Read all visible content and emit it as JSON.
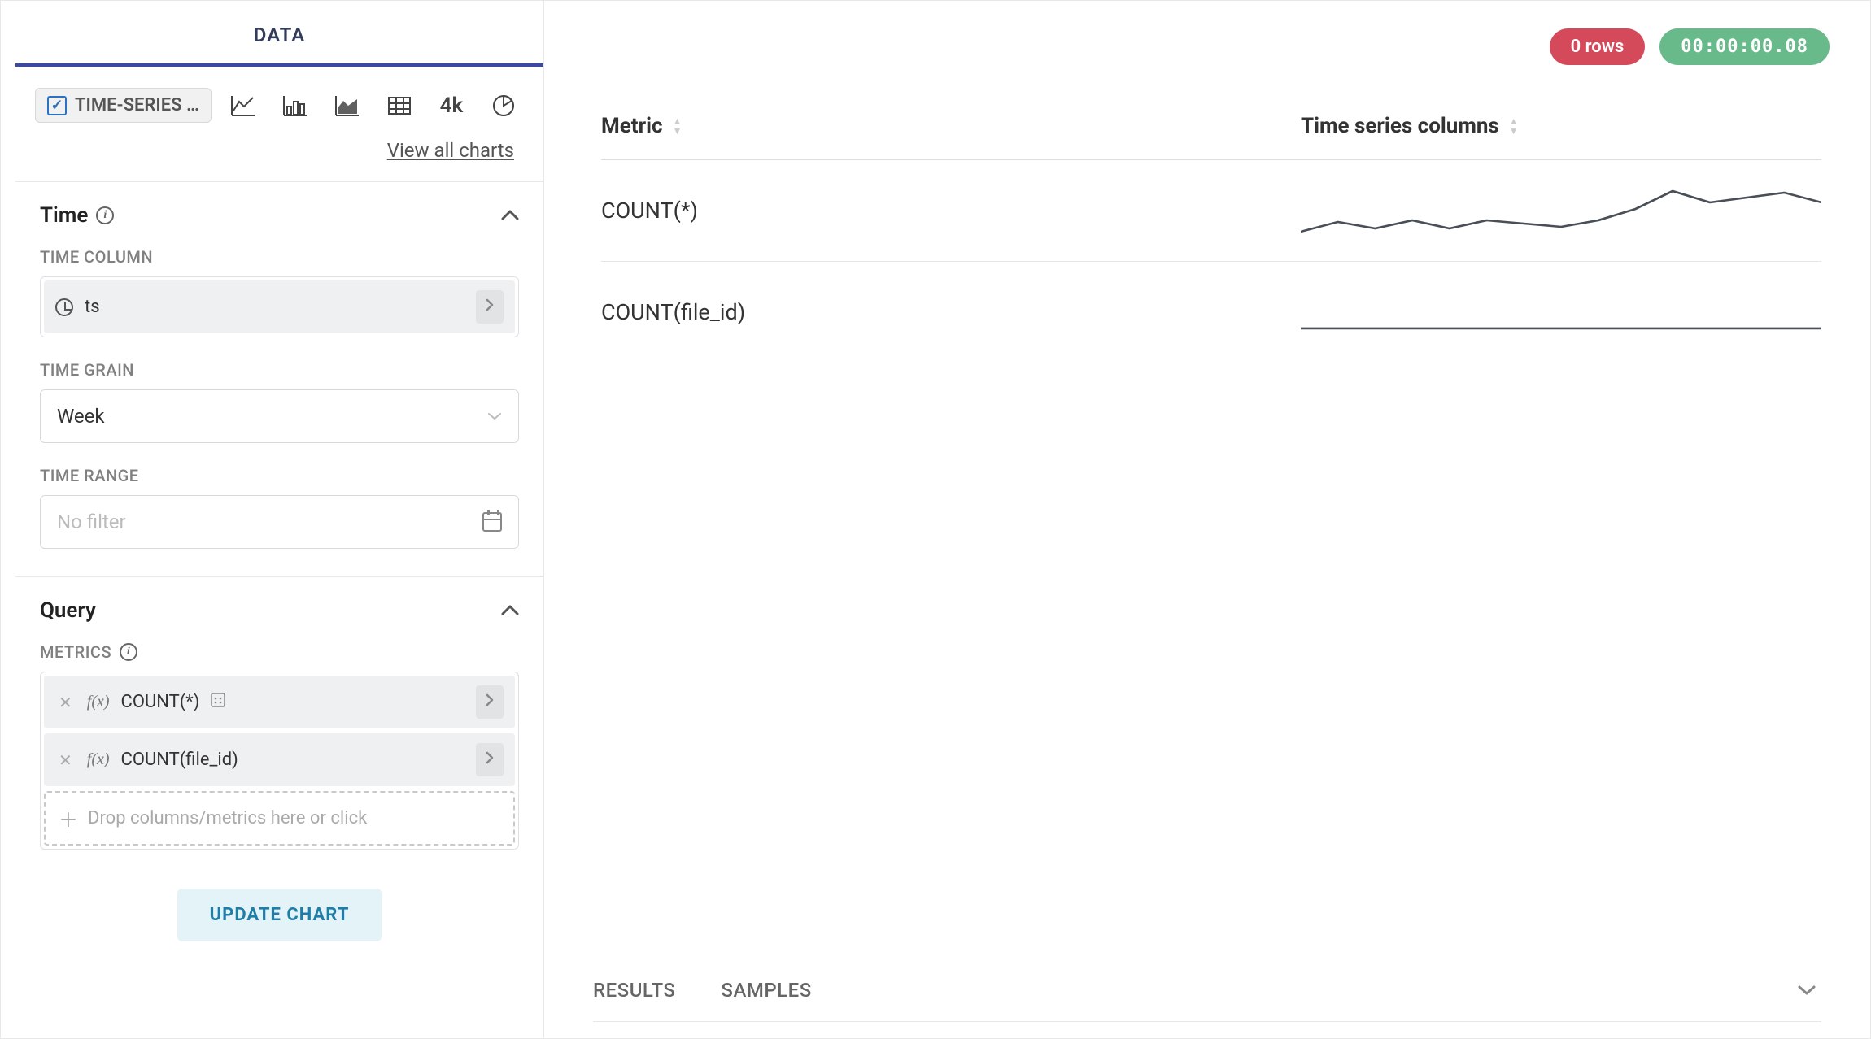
{
  "sidebar": {
    "tabs": [
      {
        "label": "DATA",
        "active": true
      }
    ],
    "viz_type_label": "TIME-SERIES …",
    "view_all_charts": "View all charts",
    "big_number_label": "4k",
    "time_section": {
      "title": "Time",
      "time_column_label": "TIME COLUMN",
      "time_column_value": "ts",
      "time_grain_label": "TIME GRAIN",
      "time_grain_value": "Week",
      "time_range_label": "TIME RANGE",
      "time_range_placeholder": "No filter"
    },
    "query_section": {
      "title": "Query",
      "metrics_label": "METRICS",
      "metrics": [
        {
          "expr": "COUNT(*)",
          "has_config_icon": true
        },
        {
          "expr": "COUNT(file_id)",
          "has_config_icon": false
        }
      ],
      "dropzone_text": "Drop columns/metrics here or click"
    },
    "update_button": "UPDATE CHART"
  },
  "main": {
    "row_count_badge": "0 rows",
    "timing_badge": "00:00:00.08",
    "columns": [
      {
        "label": "Metric"
      },
      {
        "label": "Time series columns"
      }
    ],
    "rows": [
      {
        "metric": "COUNT(*)"
      },
      {
        "metric": "COUNT(file_id)"
      }
    ],
    "bottom_tabs": [
      {
        "label": "RESULTS"
      },
      {
        "label": "SAMPLES"
      }
    ]
  },
  "chart_data": [
    {
      "type": "line",
      "title": "COUNT(*) sparkline",
      "x": [
        0,
        1,
        2,
        3,
        4,
        5,
        6,
        7,
        8,
        9,
        10,
        11,
        12,
        13,
        14
      ],
      "values": [
        44,
        56,
        48,
        58,
        48,
        58,
        54,
        50,
        58,
        72,
        94,
        80,
        86,
        92,
        80
      ],
      "ylim": [
        40,
        100
      ]
    },
    {
      "type": "line",
      "title": "COUNT(file_id) sparkline",
      "x": [
        0,
        1,
        2,
        3,
        4,
        5,
        6,
        7,
        8,
        9,
        10,
        11,
        12,
        13,
        14
      ],
      "values": [
        50,
        50,
        50,
        50,
        50,
        50,
        50,
        50,
        50,
        50,
        50,
        50,
        50,
        50,
        50
      ],
      "ylim": [
        40,
        100
      ]
    }
  ]
}
